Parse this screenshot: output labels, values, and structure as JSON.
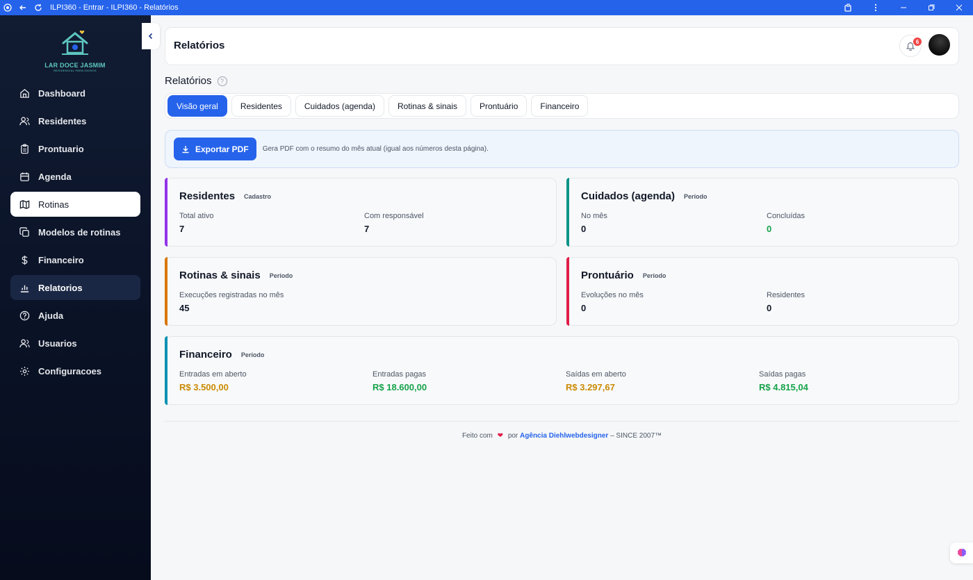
{
  "browser": {
    "title": "ILPI360 - Entrar - ILPI360 - Relatórios"
  },
  "brand": {
    "name": "LAR DOCE JASMIM",
    "tagline": "RESIDENCIAL PARA IDOSOS",
    "colors": {
      "teal": "#5ec7c0",
      "sidebar": "#0a1226",
      "accent": "#2563eb"
    }
  },
  "sidebar": {
    "items": [
      {
        "label": "Dashboard",
        "icon": "home-icon"
      },
      {
        "label": "Residentes",
        "icon": "users-icon"
      },
      {
        "label": "Prontuario",
        "icon": "clipboard-icon"
      },
      {
        "label": "Agenda",
        "icon": "calendar-icon"
      },
      {
        "label": "Rotinas",
        "icon": "map-icon"
      },
      {
        "label": "Modelos de rotinas",
        "icon": "copy-icon"
      },
      {
        "label": "Financeiro",
        "icon": "dollar-icon"
      },
      {
        "label": "Relatorios",
        "icon": "bar-chart-icon"
      },
      {
        "label": "Ajuda",
        "icon": "help-icon"
      },
      {
        "label": "Usuarios",
        "icon": "users-icon"
      },
      {
        "label": "Configuracoes",
        "icon": "settings-icon"
      }
    ]
  },
  "header": {
    "title": "Relatórios",
    "notifications": "6"
  },
  "page": {
    "title": "Relatórios",
    "help_icon": "?"
  },
  "tabs": [
    {
      "label": "Visão geral"
    },
    {
      "label": "Residentes"
    },
    {
      "label": "Cuidados (agenda)"
    },
    {
      "label": "Rotinas & sinais"
    },
    {
      "label": "Prontuário"
    },
    {
      "label": "Financeiro"
    }
  ],
  "export": {
    "button": "Exportar PDF",
    "hint": "Gera PDF com o resumo do mês atual (igual aos números desta página)."
  },
  "cards": {
    "residentes": {
      "title": "Residentes",
      "tag": "Cadastro",
      "color": "#9333ea",
      "metrics": [
        {
          "label": "Total ativo",
          "value": "7"
        },
        {
          "label": "Com responsável",
          "value": "7"
        }
      ]
    },
    "cuidados": {
      "title": "Cuidados (agenda)",
      "tag": "Período",
      "color": "#0d9488",
      "metrics": [
        {
          "label": "No mês",
          "value": "0"
        },
        {
          "label": "Concluídas",
          "value": "0"
        }
      ]
    },
    "rotinas": {
      "title": "Rotinas & sinais",
      "tag": "Período",
      "color": "#d97706",
      "metrics": [
        {
          "label": "Execuções registradas no mês",
          "value": "45"
        }
      ]
    },
    "prontuario": {
      "title": "Prontuário",
      "tag": "Período",
      "color": "#e11d48",
      "metrics": [
        {
          "label": "Evoluções no mês",
          "value": "0"
        },
        {
          "label": "Residentes",
          "value": "0"
        }
      ]
    },
    "financeiro": {
      "title": "Financeiro",
      "tag": "Período",
      "color": "#0891b2",
      "metrics": [
        {
          "label": "Entradas em aberto",
          "value": "R$ 3.500,00"
        },
        {
          "label": "Entradas pagas",
          "value": "R$ 18.600,00"
        },
        {
          "label": "Saídas em aberto",
          "value": "R$ 3.297,67"
        },
        {
          "label": "Saídas pagas",
          "value": "R$ 4.815,04"
        }
      ]
    }
  },
  "footer": {
    "made_with": "Feito com",
    "heart": "❤",
    "by": "por",
    "agency": "Agência Diehlwebdesigner",
    "since": "– SINCE 2007™"
  }
}
